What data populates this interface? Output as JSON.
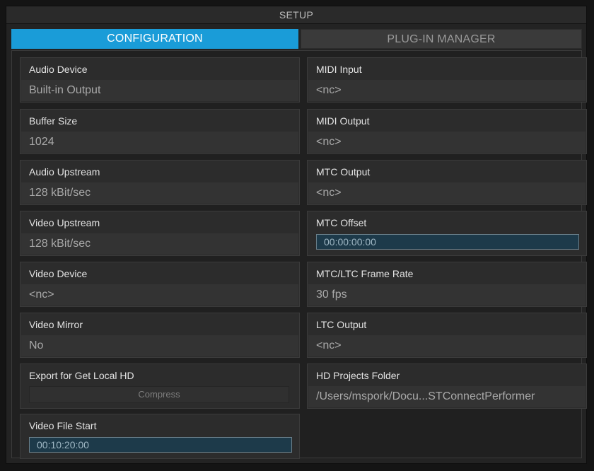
{
  "window": {
    "title": "SETUP"
  },
  "tabs": [
    {
      "label": "CONFIGURATION",
      "active": true
    },
    {
      "label": "PLUG-IN MANAGER",
      "active": false
    }
  ],
  "left": {
    "audio_device": {
      "label": "Audio Device",
      "value": "Built-in Output"
    },
    "buffer_size": {
      "label": "Buffer Size",
      "value": "1024"
    },
    "audio_upstream": {
      "label": "Audio Upstream",
      "value": "128 kBit/sec"
    },
    "video_upstream": {
      "label": "Video Upstream",
      "value": "128 kBit/sec"
    },
    "video_device": {
      "label": "Video Device",
      "value": "<nc>"
    },
    "video_mirror": {
      "label": "Video Mirror",
      "value": "No"
    },
    "export_local_hd": {
      "label": "Export for Get Local HD",
      "button": "Compress"
    },
    "video_file_start": {
      "label": "Video File Start",
      "value": "00:10:20:00"
    }
  },
  "right": {
    "midi_input": {
      "label": "MIDI Input",
      "value": "<nc>"
    },
    "midi_output": {
      "label": "MIDI Output",
      "value": "<nc>"
    },
    "mtc_output": {
      "label": "MTC Output",
      "value": "<nc>"
    },
    "mtc_offset": {
      "label": "MTC Offset",
      "value": "00:00:00:00"
    },
    "frame_rate": {
      "label": "MTC/LTC Frame Rate",
      "value": "30 fps"
    },
    "ltc_output": {
      "label": "LTC Output",
      "value": "<nc>"
    },
    "hd_projects_folder": {
      "label": "HD Projects Folder",
      "value": "/Users/mspork/Docu...STConnectPerformer"
    }
  },
  "colors": {
    "accent": "#1a9cd8",
    "panel": "#2c2c2c",
    "value_bg": "#333333",
    "timecode_bg": "#1d3a4a"
  }
}
